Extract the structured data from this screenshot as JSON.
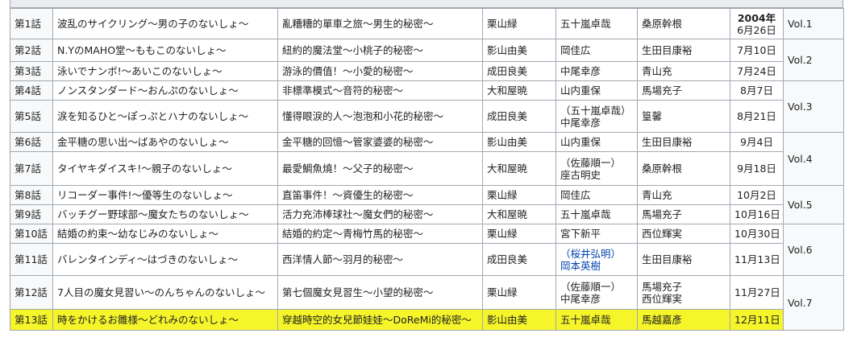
{
  "rows": [
    {
      "ep": "第1話",
      "ja": "波乱のサイクリング～男の子のないしょ～",
      "zh": "亂糟糟的單車之旅～男生的秘密～",
      "writer": "栗山緑",
      "storyboard": [
        "五十嵐卓哉"
      ],
      "director": [
        "桑原幹根"
      ],
      "year": "2004年",
      "date": "6月26日",
      "vol": "Vol.1",
      "rowspan": 1
    },
    {
      "ep": "第2話",
      "ja": "N.YのMAHO堂～ももこのないしょ～",
      "zh": "紐約的魔法堂～小桃子的秘密～",
      "writer": "影山由美",
      "storyboard": [
        "岡佳広"
      ],
      "director": [
        "生田目康裕"
      ],
      "date": "7月10日",
      "vol": "Vol.2",
      "rowspan": 2
    },
    {
      "ep": "第3話",
      "ja": "泳いでナンボ!～あいこのないしょ～",
      "zh": "游泳的價值！～小愛的秘密～",
      "writer": "成田良美",
      "storyboard": [
        "中尾幸彦"
      ],
      "director": [
        "青山充"
      ],
      "date": "7月24日"
    },
    {
      "ep": "第4話",
      "ja": "ノンスタンダード～おんぷのないしょ～",
      "zh": "非標準模式～音符的秘密～",
      "writer": "大和屋暁",
      "storyboard": [
        "山内重保"
      ],
      "director": [
        "馬場充子"
      ],
      "date": "8月7日",
      "vol": "Vol.3",
      "rowspan": 2
    },
    {
      "ep": "第5話",
      "ja": "涙を知るひと～ぽっぷとハナのないしょ～",
      "zh": "懂得眼淚的人～泡泡和小花的秘密～",
      "writer": "成田良美",
      "storyboard": [
        "（五十嵐卓哉）",
        "中尾幸彦"
      ],
      "director": [
        "篁馨"
      ],
      "date": "8月21日"
    },
    {
      "ep": "第6話",
      "ja": "金平糖の思い出～ばあやのないしょ～",
      "zh": "金平糖的回憶～管家婆婆的秘密～",
      "writer": "影山由美",
      "storyboard": [
        "山内重保"
      ],
      "director": [
        "生田目康裕"
      ],
      "date": "9月4日",
      "vol": "Vol.4",
      "rowspan": 2
    },
    {
      "ep": "第7話",
      "ja": "タイヤキダイスキ!～親子のないしょ～",
      "zh": "最愛鯛魚燒！～父子的秘密～",
      "writer": "大和屋暁",
      "storyboard": [
        "（佐藤順一）",
        "座古明史"
      ],
      "director": [
        "桑原幹根"
      ],
      "date": "9月18日"
    },
    {
      "ep": "第8話",
      "ja": "リコーダー事件!～優等生のないしょ～",
      "zh": "直笛事件！～資優生的秘密～",
      "writer": "栗山緑",
      "storyboard": [
        "岡佳広"
      ],
      "director": [
        "青山充"
      ],
      "date": "10月2日",
      "vol": "Vol.5",
      "rowspan": 2
    },
    {
      "ep": "第9話",
      "ja": "バッチグー野球部～魔女たちのないしょ～",
      "zh": "活力充沛棒球社～魔女們的秘密～",
      "writer": "大和屋暁",
      "storyboard": [
        "五十嵐卓哉"
      ],
      "director": [
        "馬場充子"
      ],
      "date": "10月16日"
    },
    {
      "ep": "第10話",
      "ja": "結婚の約束～幼なじみのないしょ～",
      "zh": "結婚的約定～青梅竹馬的秘密～",
      "writer": "栗山緑",
      "storyboard": [
        "宮下新平"
      ],
      "director": [
        "西位輝実"
      ],
      "date": "10月30日",
      "vol": "Vol.6",
      "rowspan": 2
    },
    {
      "ep": "第11話",
      "ja": "バレンタインディ～はづきのないしょ～",
      "zh": "西洋情人節～羽月的秘密～",
      "writer": "成田良美",
      "storyboard": [
        "（桜井弘明）",
        "岡本英樹"
      ],
      "storyboard_link": true,
      "director": [
        "生田目康裕"
      ],
      "date": "11月13日"
    },
    {
      "ep": "第12話",
      "ja": "7人目の魔女見習い～のんちゃんのないしょ～",
      "zh": "第七個魔女見習生～小望的秘密～",
      "writer": "栗山緑",
      "storyboard": [
        "（佐藤順一）",
        "中尾幸彦"
      ],
      "director": [
        "馬場充子",
        "西位輝実"
      ],
      "date": "11月27日",
      "vol": "Vol.7",
      "rowspan": 2
    },
    {
      "ep": "第13話",
      "ja": "時をかけるお雛様～どれみのないしょ～",
      "zh": "穿越時空的女兒節娃娃～DoReMi的秘密～",
      "writer": "影山由美",
      "storyboard": [
        "五十嵐卓哉"
      ],
      "director": [
        "馬越嘉彥"
      ],
      "date": "12月11日",
      "highlight": true
    }
  ],
  "colors": {
    "highlight": "#f5f52a",
    "link": "#0645ad",
    "border": "#a2a9b1",
    "header_bg": "#f8f9fa"
  }
}
